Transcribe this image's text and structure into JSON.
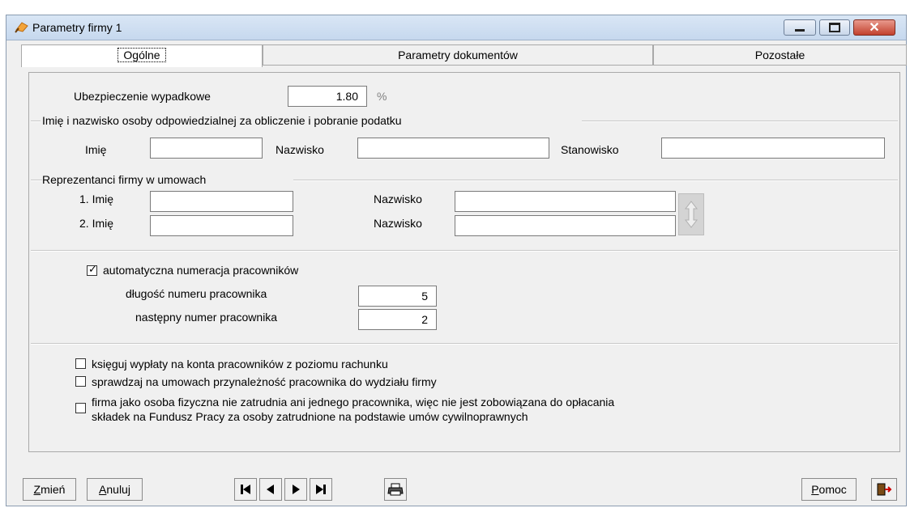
{
  "window": {
    "title": "Parametry firmy 1",
    "close_glyph": "✕"
  },
  "tabs": [
    {
      "label": "Ogólne"
    },
    {
      "label": "Parametry dokumentów"
    },
    {
      "label": "Pozostałe"
    }
  ],
  "insurance": {
    "label": "Ubezpieczenie wypadkowe",
    "value": "1.80",
    "unit": "%"
  },
  "tax_person": {
    "legend": "Imię i nazwisko osoby odpowiedzialnej za obliczenie i pobranie podatku",
    "first_name_label": "Imię",
    "first_name_value": "",
    "last_name_label": "Nazwisko",
    "last_name_value": "",
    "position_label": "Stanowisko",
    "position_value": ""
  },
  "representatives": {
    "legend": "Reprezentanci firmy w umowach",
    "rows": [
      {
        "first_label": "1. Imię",
        "first_value": "",
        "last_label": "Nazwisko",
        "last_value": ""
      },
      {
        "first_label": "2. Imię",
        "first_value": "",
        "last_label": "Nazwisko",
        "last_value": ""
      }
    ]
  },
  "numbering": {
    "auto_label": "automatyczna numeracja pracowników",
    "auto_checked": true,
    "length_label": "długość numeru pracownika",
    "length_value": "5",
    "next_label": "następny numer pracownika",
    "next_value": "2"
  },
  "options": [
    {
      "label": "księguj wypłaty na konta pracowników z poziomu rachunku",
      "checked": false
    },
    {
      "label": "sprawdzaj na umowach przynależność pracownika do wydziału firmy",
      "checked": false
    },
    {
      "label_line1": "firma jako osoba fizyczna nie zatrudnia ani jednego pracownika, więc nie jest zobowiązana do opłacania",
      "label_line2": "składek na Fundusz Pracy za osoby zatrudnione na podstawie umów cywilnoprawnych",
      "checked": false
    }
  ],
  "footer": {
    "change_label_first": "Z",
    "change_label_rest": "mień",
    "cancel_label_first": "A",
    "cancel_label_rest": "nuluj",
    "help_label_first": "P",
    "help_label_rest": "omoc",
    "icons": [
      "first-record-icon",
      "previous-record-icon",
      "next-record-icon",
      "last-record-icon",
      "print-icon",
      "exit-icon"
    ]
  }
}
